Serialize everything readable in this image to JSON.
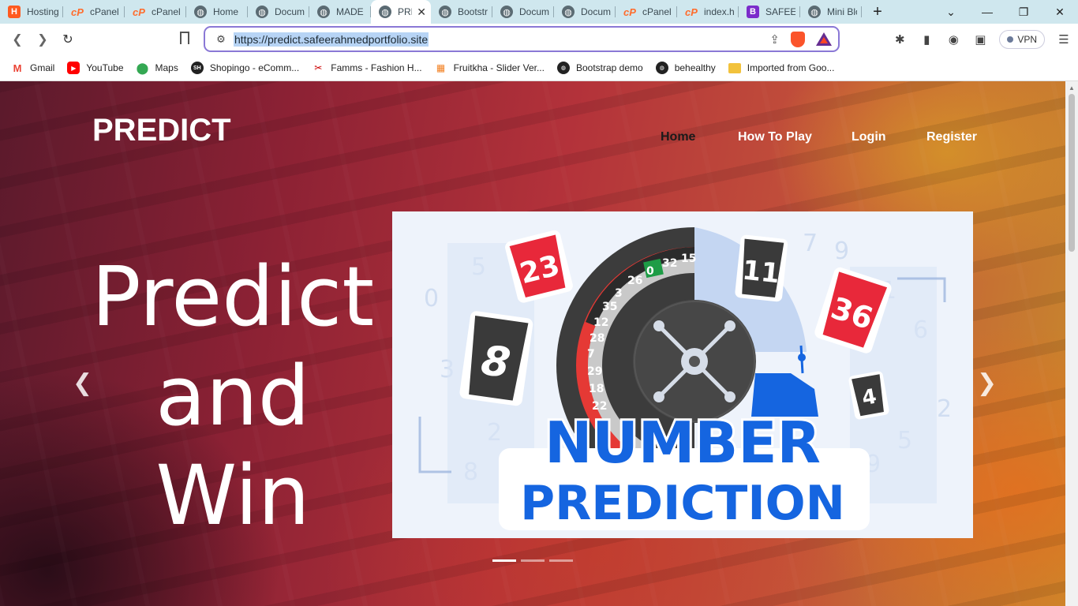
{
  "browser": {
    "tabs": [
      {
        "title": "Hosting",
        "icon": "hostinger-icon"
      },
      {
        "title": "cPanel -",
        "icon": "cpanel-icon"
      },
      {
        "title": "cPanel -",
        "icon": "cpanel-icon"
      },
      {
        "title": "Home",
        "icon": "globe-icon"
      },
      {
        "title": "Docume",
        "icon": "globe-icon"
      },
      {
        "title": "MADE E",
        "icon": "globe-icon"
      },
      {
        "title": "PRE",
        "icon": "globe-icon",
        "active": true
      },
      {
        "title": "Bootstra",
        "icon": "globe-icon"
      },
      {
        "title": "Docume",
        "icon": "globe-icon"
      },
      {
        "title": "Docume",
        "icon": "globe-icon"
      },
      {
        "title": "cPanel F",
        "icon": "cpanel-icon"
      },
      {
        "title": "index.ht",
        "icon": "cpanel-icon"
      },
      {
        "title": "SAFEER",
        "icon": "bootstrap-icon"
      },
      {
        "title": "Mini Blo",
        "icon": "globe-icon"
      }
    ],
    "url": "https://predict.safeerahmedportfolio.site",
    "vpn_label": "VPN",
    "bookmarks": [
      {
        "label": "Gmail",
        "icon": "gmail-icon"
      },
      {
        "label": "YouTube",
        "icon": "youtube-icon"
      },
      {
        "label": "Maps",
        "icon": "maps-icon"
      },
      {
        "label": "Shopingo - eComm...",
        "icon": "shopingo-icon"
      },
      {
        "label": "Famms - Fashion H...",
        "icon": "famms-icon"
      },
      {
        "label": "Fruitkha - Slider Ver...",
        "icon": "fruitkha-icon"
      },
      {
        "label": "Bootstrap demo",
        "icon": "globe-icon"
      },
      {
        "label": "behealthy",
        "icon": "globe-icon"
      },
      {
        "label": "Imported from Goo...",
        "icon": "folder-icon"
      }
    ]
  },
  "site": {
    "brand": "PREDICT",
    "nav": [
      {
        "label": "Home",
        "active": true
      },
      {
        "label": "How To Play"
      },
      {
        "label": "Login"
      },
      {
        "label": "Register"
      }
    ],
    "hero": {
      "line1": "Predict",
      "line2": "and",
      "line3": "Win"
    },
    "slide": {
      "title_line1": "NUMBER",
      "title_line2": "PREDICTION",
      "cards": [
        "23",
        "8",
        "11",
        "36",
        "4"
      ],
      "wheel_numbers": [
        "32",
        "15",
        "0",
        "26",
        "3",
        "35",
        "12",
        "28",
        "7",
        "29",
        "18",
        "22"
      ]
    },
    "carousel": {
      "slides": 3,
      "active_index": 0
    },
    "colors": {
      "accent_blue": "#1565e0",
      "card_red": "#e8283a",
      "card_dark": "#3a3a3a",
      "wheel_green": "#1e9c46"
    }
  }
}
